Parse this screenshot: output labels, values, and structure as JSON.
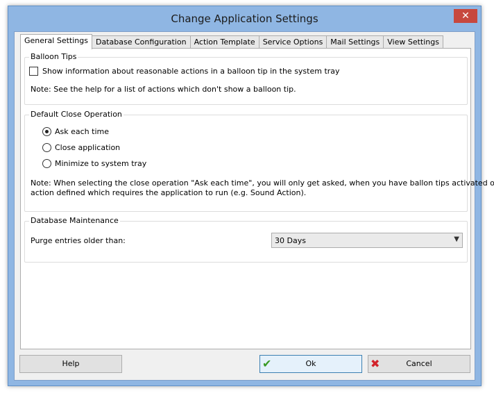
{
  "window": {
    "title": "Change Application Settings",
    "close_glyph": "✕"
  },
  "tabs": [
    {
      "label": "General Settings",
      "active": true
    },
    {
      "label": "Database Configuration"
    },
    {
      "label": "Action Template"
    },
    {
      "label": "Service Options"
    },
    {
      "label": "Mail Settings"
    },
    {
      "label": "View Settings"
    }
  ],
  "balloon_tips": {
    "legend": "Balloon Tips",
    "checkbox_label": "Show information about reasonable actions in a balloon tip in the system tray",
    "checked": false,
    "note": "Note: See the help for a list of actions which don't show a balloon tip."
  },
  "close_operation": {
    "legend": "Default Close Operation",
    "options": [
      {
        "label": "Ask each time",
        "selected": true
      },
      {
        "label": "Close application",
        "selected": false
      },
      {
        "label": "Minimize to system tray",
        "selected": false
      }
    ],
    "note_line1": "Note: When selecting the close operation \"Ask each time\", you will only get asked, when you have ballon tips activated or an",
    "note_line2": "action defined which requires the application to run (e.g. Sound Action)."
  },
  "maintenance": {
    "legend": "Database Maintenance",
    "purge_label": "Purge entries older than:",
    "purge_value": "30 Days"
  },
  "buttons": {
    "help": "Help",
    "ok": "Ok",
    "cancel": "Cancel"
  },
  "icons": {
    "ok_icon": "check-icon",
    "cancel_icon": "x-icon",
    "ok_color": "#3a9a24",
    "cancel_color": "#d2222a"
  }
}
